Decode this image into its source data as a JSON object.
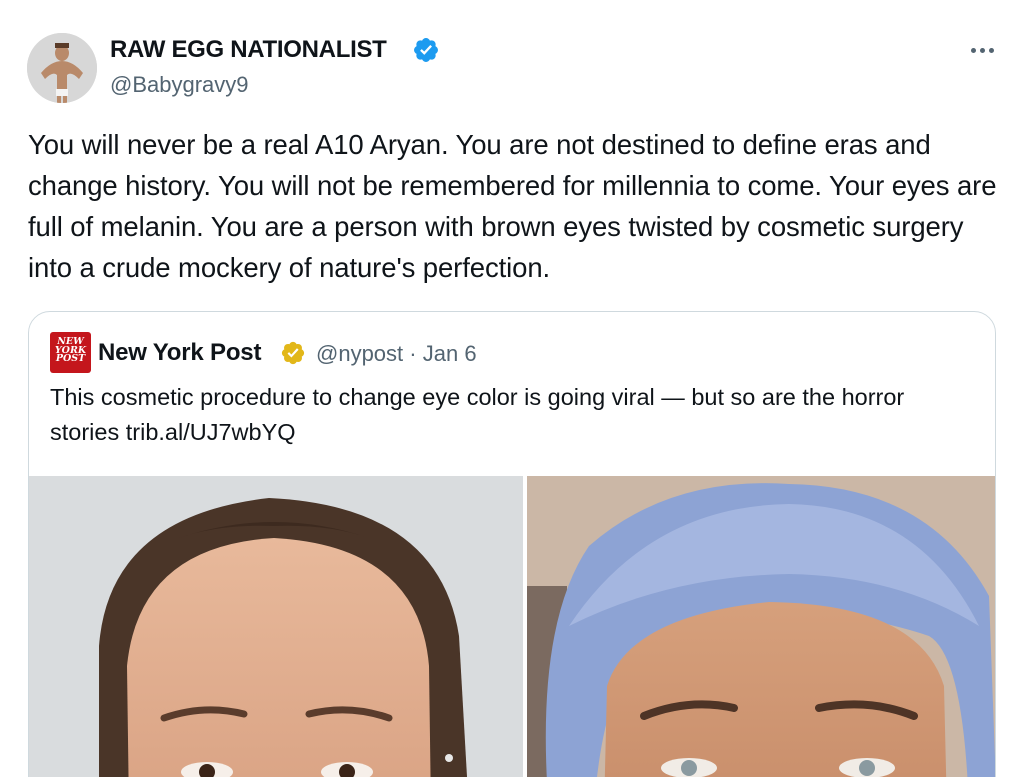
{
  "tweet": {
    "display_name": "RAW EGG NATIONALIST",
    "handle": "@Babygravy9",
    "text": "You will never be a real A10 Aryan. You are not destined to define eras and change history. You will not be remembered for millennia to come. Your eyes are full of melanin. You are a person with brown eyes twisted by cosmetic surgery into a crude mockery of nature's perfection.",
    "verified_badge": "blue-check-icon",
    "more_icon": "more-horizontal-icon"
  },
  "quote": {
    "logo_text": "NEW YORK POST",
    "display_name": "New York Post",
    "verified_badge": "gold-check-icon",
    "handle": "@nypost",
    "separator": "·",
    "date": "Jan 6",
    "text": "This cosmetic procedure to change eye color is going viral — but so are the horror stories trib.al/UJ7wbYQ"
  },
  "colors": {
    "text_primary": "#0f1419",
    "text_secondary": "#536471",
    "verified_blue": "#1d9bf0",
    "verified_gold": "#e2b719",
    "border": "#cfd9de",
    "nypost_red": "#c4161c"
  }
}
